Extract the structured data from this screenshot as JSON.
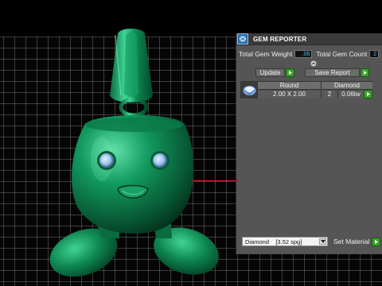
{
  "panel": {
    "title": "GEM REPORTER",
    "total_weight_label": "Total Gem Weight",
    "total_weight_value": ".06",
    "total_count_label": "Total Gem Count",
    "total_count_value": "2",
    "update_label": "Update",
    "save_report_label": "Save Report",
    "table": {
      "headers": [
        "Round",
        "Diamond"
      ],
      "row": {
        "size": "2.00 X 2.00",
        "count": "2",
        "weight": "0.06tw"
      }
    },
    "material_select_value": "Diamond    [3.52 spg]",
    "set_material_label": "Set Material"
  },
  "colors": {
    "model_green": "#0f8a55",
    "panel_bg": "#555555",
    "play_green": "#3aa02a",
    "value_cyan": "#30d0ff",
    "axis_red": "#d02020"
  },
  "icons": [
    "gem-reporter-logo-icon",
    "collapse-icon",
    "play-arrow-icon",
    "round-gem-icon",
    "dropdown-arrow-icon"
  ]
}
